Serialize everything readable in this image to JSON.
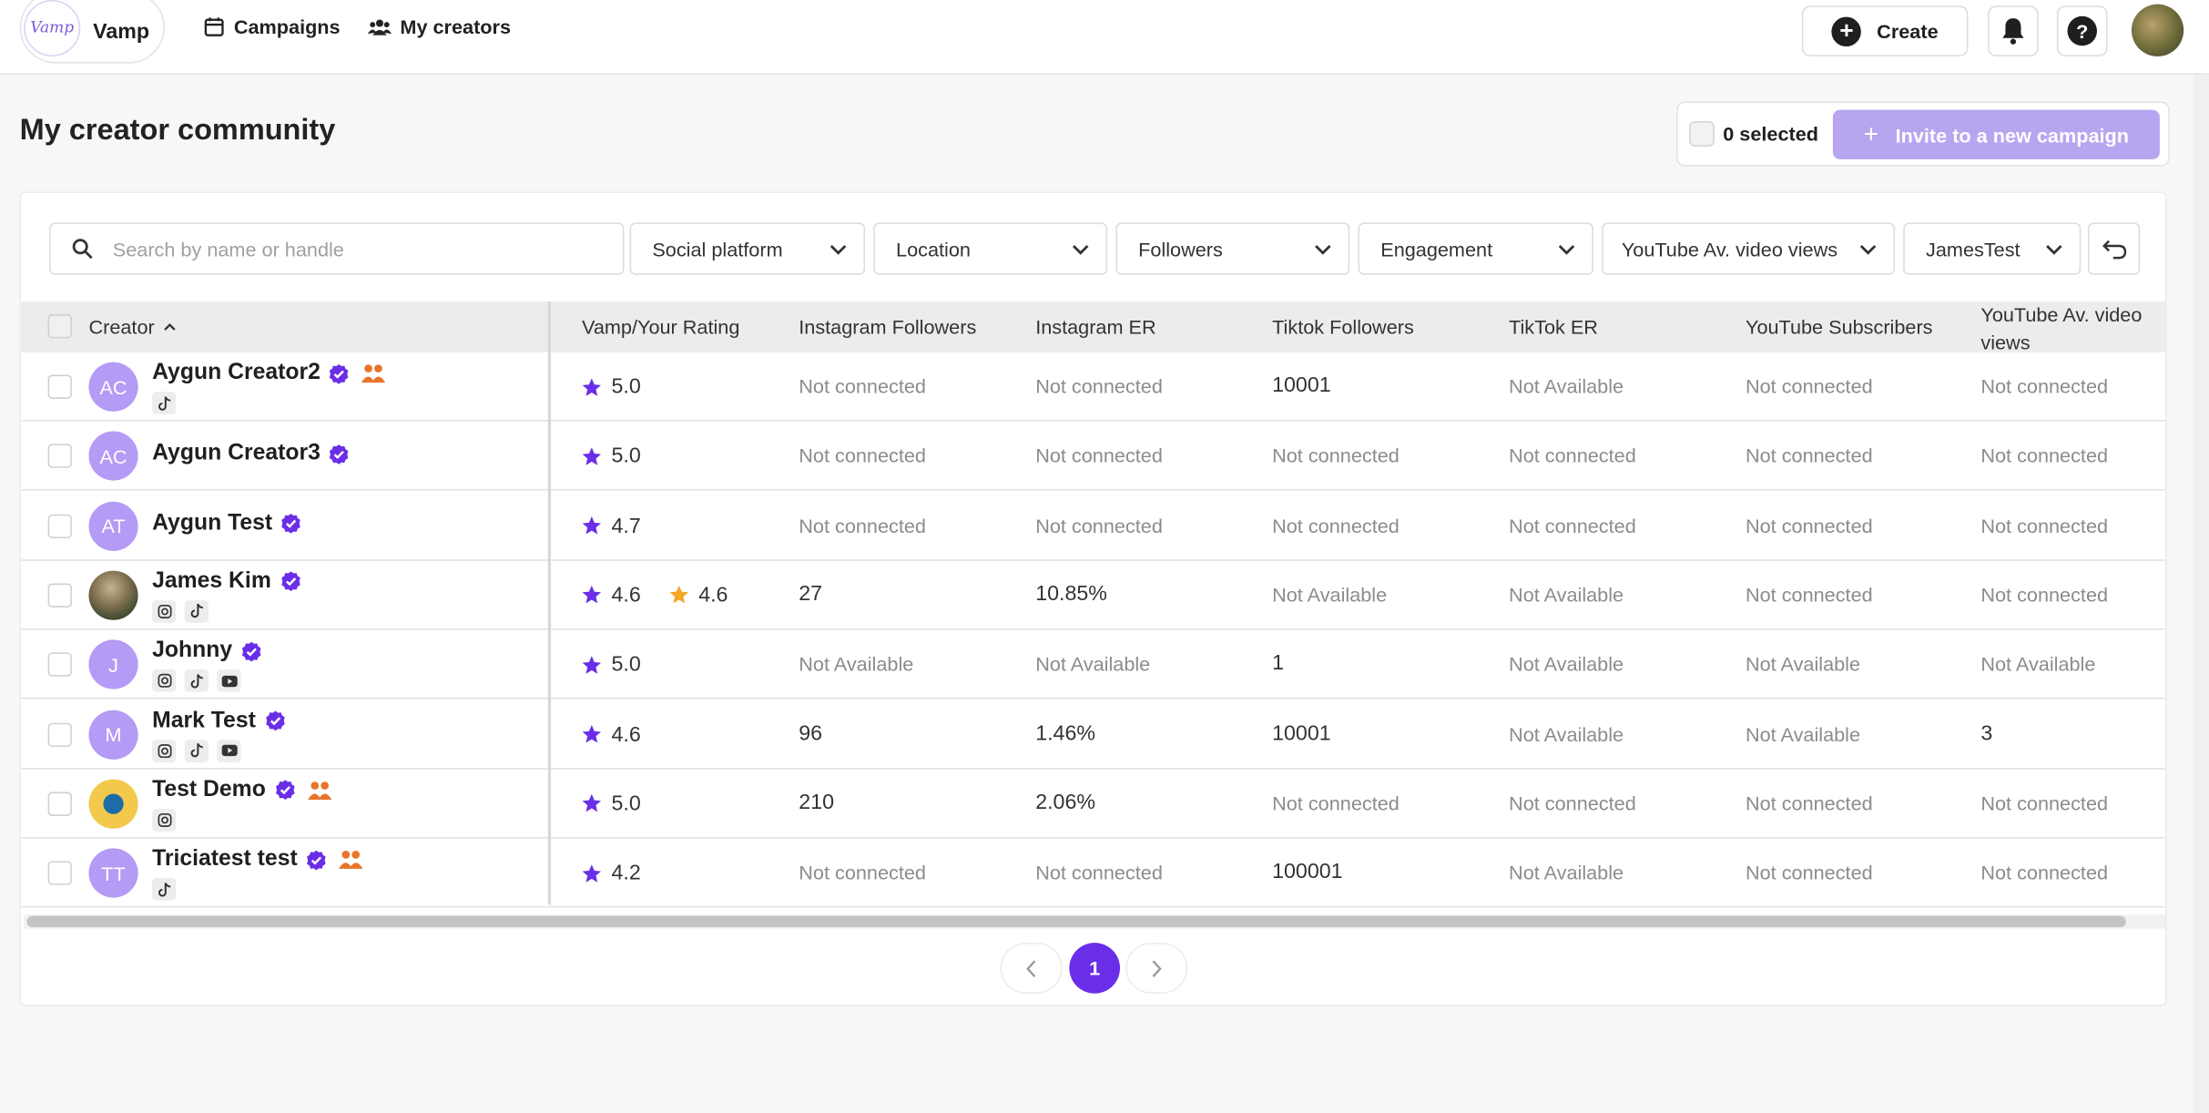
{
  "nav": {
    "brand_name": "Vamp",
    "brand_logo_text": "Vamp",
    "campaigns_label": "Campaigns",
    "creators_label": "My creators",
    "create_label": "Create"
  },
  "page": {
    "title": "My creator community",
    "selected_label": "0 selected",
    "invite_label": "Invite to a new campaign"
  },
  "search": {
    "placeholder": "Search by name or handle"
  },
  "filters": {
    "social_platform": "Social platform",
    "location": "Location",
    "followers": "Followers",
    "engagement": "Engagement",
    "youtube_views": "YouTube Av. video views",
    "list": "JamesTest"
  },
  "table": {
    "headers": {
      "creator": "Creator",
      "rating": "Vamp/Your Rating",
      "ig_followers": "Instagram Followers",
      "ig_er": "Instagram ER",
      "tt_followers": "Tiktok Followers",
      "tt_er": "TikTok ER",
      "yt_subs": "YouTube Subscribers",
      "yt_views_1": "YouTube Av. video",
      "yt_views_2": "views"
    },
    "rows": [
      {
        "initials": "AC",
        "name": "Aygun Creator2",
        "rating": "5.0",
        "your_rating": "",
        "ig_followers": "Not connected",
        "ig_er": "Not connected",
        "tt_followers": "10001",
        "tt_er": "Not Available",
        "yt_subs": "Not connected",
        "yt_views": "Not connected",
        "platforms": [
          "tiktok"
        ],
        "community": true
      },
      {
        "initials": "AC",
        "name": "Aygun Creator3",
        "rating": "5.0",
        "your_rating": "",
        "ig_followers": "Not connected",
        "ig_er": "Not connected",
        "tt_followers": "Not connected",
        "tt_er": "Not connected",
        "yt_subs": "Not connected",
        "yt_views": "Not connected",
        "platforms": [],
        "community": false
      },
      {
        "initials": "AT",
        "name": "Aygun Test",
        "rating": "4.7",
        "your_rating": "",
        "ig_followers": "Not connected",
        "ig_er": "Not connected",
        "tt_followers": "Not connected",
        "tt_er": "Not connected",
        "yt_subs": "Not connected",
        "yt_views": "Not connected",
        "platforms": [],
        "community": false
      },
      {
        "initials": "",
        "name": "James Kim",
        "rating": "4.6",
        "your_rating": "4.6",
        "ig_followers": "27",
        "ig_er": "10.85%",
        "tt_followers": "Not Available",
        "tt_er": "Not Available",
        "yt_subs": "Not connected",
        "yt_views": "Not connected",
        "platforms": [
          "instagram",
          "tiktok"
        ],
        "community": false
      },
      {
        "initials": "J",
        "name": "Johnny",
        "rating": "5.0",
        "your_rating": "",
        "ig_followers": "Not Available",
        "ig_er": "Not Available",
        "tt_followers": "1",
        "tt_er": "Not Available",
        "yt_subs": "Not Available",
        "yt_views": "Not Available",
        "platforms": [
          "instagram",
          "tiktok",
          "youtube"
        ],
        "community": false
      },
      {
        "initials": "M",
        "name": "Mark Test",
        "rating": "4.6",
        "your_rating": "",
        "ig_followers": "96",
        "ig_er": "1.46%",
        "tt_followers": "10001",
        "tt_er": "Not Available",
        "yt_subs": "Not Available",
        "yt_views": "3",
        "platforms": [
          "instagram",
          "tiktok",
          "youtube"
        ],
        "community": false
      },
      {
        "initials": "",
        "name": "Test Demo",
        "rating": "5.0",
        "your_rating": "",
        "ig_followers": "210",
        "ig_er": "2.06%",
        "tt_followers": "Not connected",
        "tt_er": "Not connected",
        "yt_subs": "Not connected",
        "yt_views": "Not connected",
        "platforms": [
          "instagram"
        ],
        "community": true
      },
      {
        "initials": "TT",
        "name": "Triciatest test",
        "rating": "4.2",
        "your_rating": "",
        "ig_followers": "Not connected",
        "ig_er": "Not connected",
        "tt_followers": "100001",
        "tt_er": "Not Available",
        "yt_subs": "Not connected",
        "yt_views": "Not connected",
        "platforms": [
          "tiktok"
        ],
        "community": true
      }
    ]
  },
  "pagination": {
    "current": "1"
  },
  "colors": {
    "accent": "#6a2ee8",
    "avatar": "#b49bf5",
    "invite": "#b7a5ef",
    "star": "#6a2ee8",
    "star_yours": "#f5a623",
    "community": "#e8742a"
  }
}
